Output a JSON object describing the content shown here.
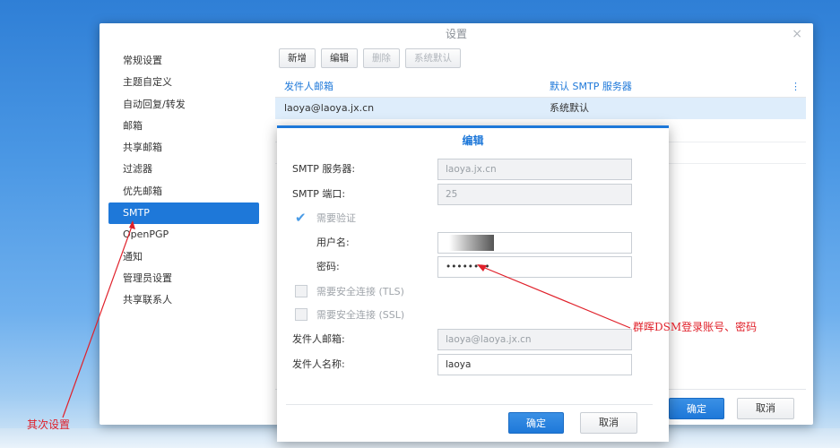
{
  "window": {
    "title": "设置",
    "close_glyph": "×"
  },
  "sidebar": {
    "items": [
      {
        "label": "常规设置"
      },
      {
        "label": "主题自定义"
      },
      {
        "label": "自动回复/转发"
      },
      {
        "label": "邮箱"
      },
      {
        "label": "共享邮箱"
      },
      {
        "label": "过滤器"
      },
      {
        "label": "优先邮箱"
      },
      {
        "label": "SMTP",
        "active": true
      },
      {
        "label": "OpenPGP"
      },
      {
        "label": "通知"
      },
      {
        "label": "管理员设置"
      },
      {
        "label": "共享联系人"
      }
    ]
  },
  "toolbar": {
    "new_label": "新增",
    "edit_label": "编辑",
    "delete_label": "删除",
    "system_default_label": "系统默认"
  },
  "grid": {
    "columns": [
      "发件人邮箱",
      "默认 SMTP 服务器"
    ],
    "menu_glyph": "⋮",
    "rows": [
      {
        "sender": "laoya@laoya.jx.cn",
        "server": "系统默认"
      }
    ]
  },
  "window_footer": {
    "ok_label": "确定",
    "cancel_label": "取消"
  },
  "dialog": {
    "title": "编辑",
    "smtp_server_label": "SMTP 服务器:",
    "smtp_server_value": "laoya.jx.cn",
    "smtp_port_label": "SMTP 端口:",
    "smtp_port_value": "25",
    "auth_label": "需要验证",
    "auth_checked": true,
    "username_label": "用户名:",
    "password_label": "密码:",
    "password_value": "••••••••",
    "tls_label": "需要安全连接 (TLS)",
    "ssl_label": "需要安全连接 (SSL)",
    "sender_email_label": "发件人邮箱:",
    "sender_email_value": "laoya@laoya.jx.cn",
    "sender_name_label": "发件人名称:",
    "sender_name_value": "laoya",
    "ok_label": "确定",
    "cancel_label": "取消"
  },
  "annotations": {
    "left": "其次设置",
    "right": "群晖DSM登录账号、密码"
  },
  "colors": {
    "accent": "#1e78d9",
    "annotation": "#e0202a",
    "selected_row": "#deedfb"
  }
}
